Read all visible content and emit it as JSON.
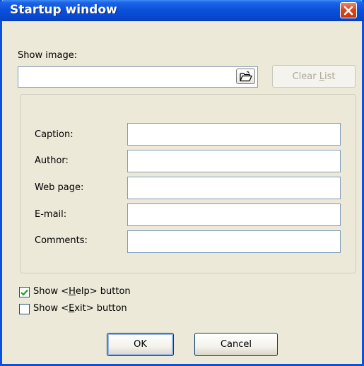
{
  "window": {
    "title": "Startup window",
    "close_icon": "close-icon"
  },
  "show_image": {
    "label": "Show image:",
    "value": "",
    "browse_icon": "folder-open-icon",
    "clear_label_pre": "Clear ",
    "clear_label_accel": "L",
    "clear_label_post": "ist",
    "clear_enabled": false
  },
  "form": {
    "caption_label": "Caption:",
    "caption_value": "",
    "author_label": "Author:",
    "author_value": "",
    "webpage_label": "Web page:",
    "webpage_value": "",
    "email_label": "E-mail:",
    "email_value": "",
    "comments_label": "Comments:",
    "comments_value": ""
  },
  "options": {
    "help_pre": "Show <",
    "help_accel": "H",
    "help_post": "elp> button",
    "help_checked": true,
    "exit_pre": "Show <",
    "exit_accel": "E",
    "exit_post": "xit> button",
    "exit_checked": false
  },
  "buttons": {
    "ok_label": "OK",
    "cancel_label": "Cancel"
  },
  "colors": {
    "titlebar": "#0a52dc",
    "close_button": "#d6491f",
    "dialog_background": "#ece9d8",
    "input_border": "#7f9db9",
    "check_mark": "#21a121"
  }
}
